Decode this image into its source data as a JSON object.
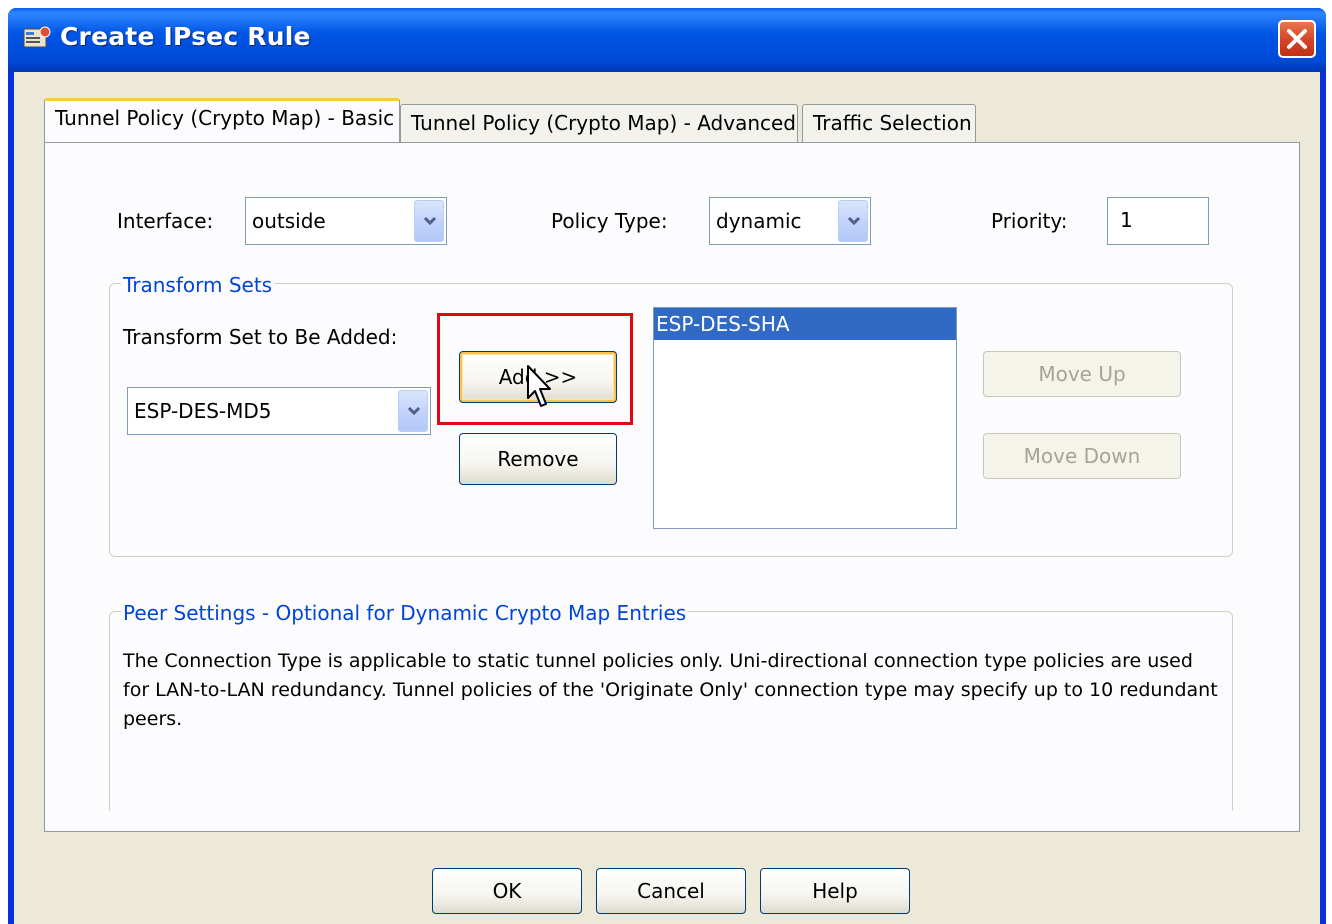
{
  "window": {
    "title": "Create IPsec Rule"
  },
  "tabs": [
    {
      "label": "Tunnel Policy (Crypto Map) - Basic",
      "active": true
    },
    {
      "label": "Tunnel Policy (Crypto Map) - Advanced",
      "active": false
    },
    {
      "label": "Traffic Selection",
      "active": false
    }
  ],
  "form": {
    "interface_label": "Interface:",
    "interface_value": "outside",
    "policy_type_label": "Policy Type:",
    "policy_type_value": "dynamic",
    "priority_label": "Priority:",
    "priority_value": "1"
  },
  "transform_sets": {
    "group_label": "Transform Sets",
    "to_be_added_label": "Transform Set to Be Added:",
    "to_be_added_value": "ESP-DES-MD5",
    "add_label": "Add >>",
    "remove_label": "Remove",
    "selected_items": [
      "ESP-DES-SHA"
    ],
    "move_up_label": "Move Up",
    "move_down_label": "Move Down"
  },
  "peer_settings": {
    "group_label": "Peer Settings  -  Optional for Dynamic Crypto Map Entries",
    "description": "The Connection Type is applicable to static tunnel policies only. Uni-directional connection type policies are used for LAN-to-LAN redundancy. Tunnel policies of the 'Originate Only' connection type may specify up to 10 redundant peers."
  },
  "footer": {
    "ok_label": "OK",
    "cancel_label": "Cancel",
    "help_label": "Help"
  },
  "colors": {
    "titlebar": "#0055e5",
    "dialog_bg": "#ece9d8",
    "group_label": "#0046d5",
    "selection": "#316ac5",
    "highlight_box": "#e30613"
  }
}
